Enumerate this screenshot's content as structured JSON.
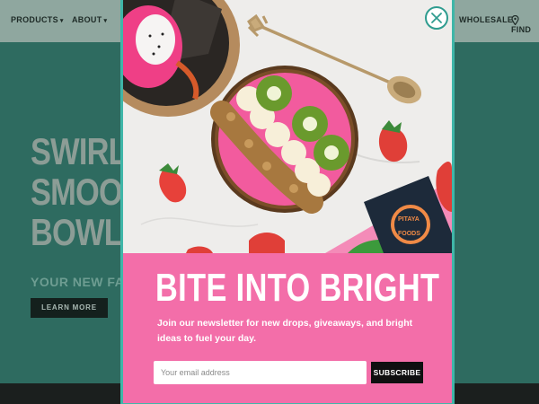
{
  "nav": {
    "products": "PRODUCTS",
    "about": "ABOUT",
    "wholesale": "WHOLESALE",
    "find": "FIND"
  },
  "hero": {
    "title_lines": [
      "SWIRL",
      "SMOOT",
      "BOWLS"
    ],
    "subtitle": "YOUR NEW FA",
    "learn_more": "LEARN MORE"
  },
  "modal": {
    "headline": "BITE INTO BRIGHT",
    "blurb": "Join our newsletter for new drops, giveaways, and bright ideas to fuel your day.",
    "email_placeholder": "Your email address",
    "subscribe_label": "SUBSCRIBE",
    "product_pack_lines": [
      "PITAYA",
      "FOODS"
    ]
  },
  "colors": {
    "modal_pink": "#f36ea9",
    "accent_teal": "#3fb6a8",
    "hero_green": "#2e6b60",
    "button_black": "#0f0f10"
  }
}
